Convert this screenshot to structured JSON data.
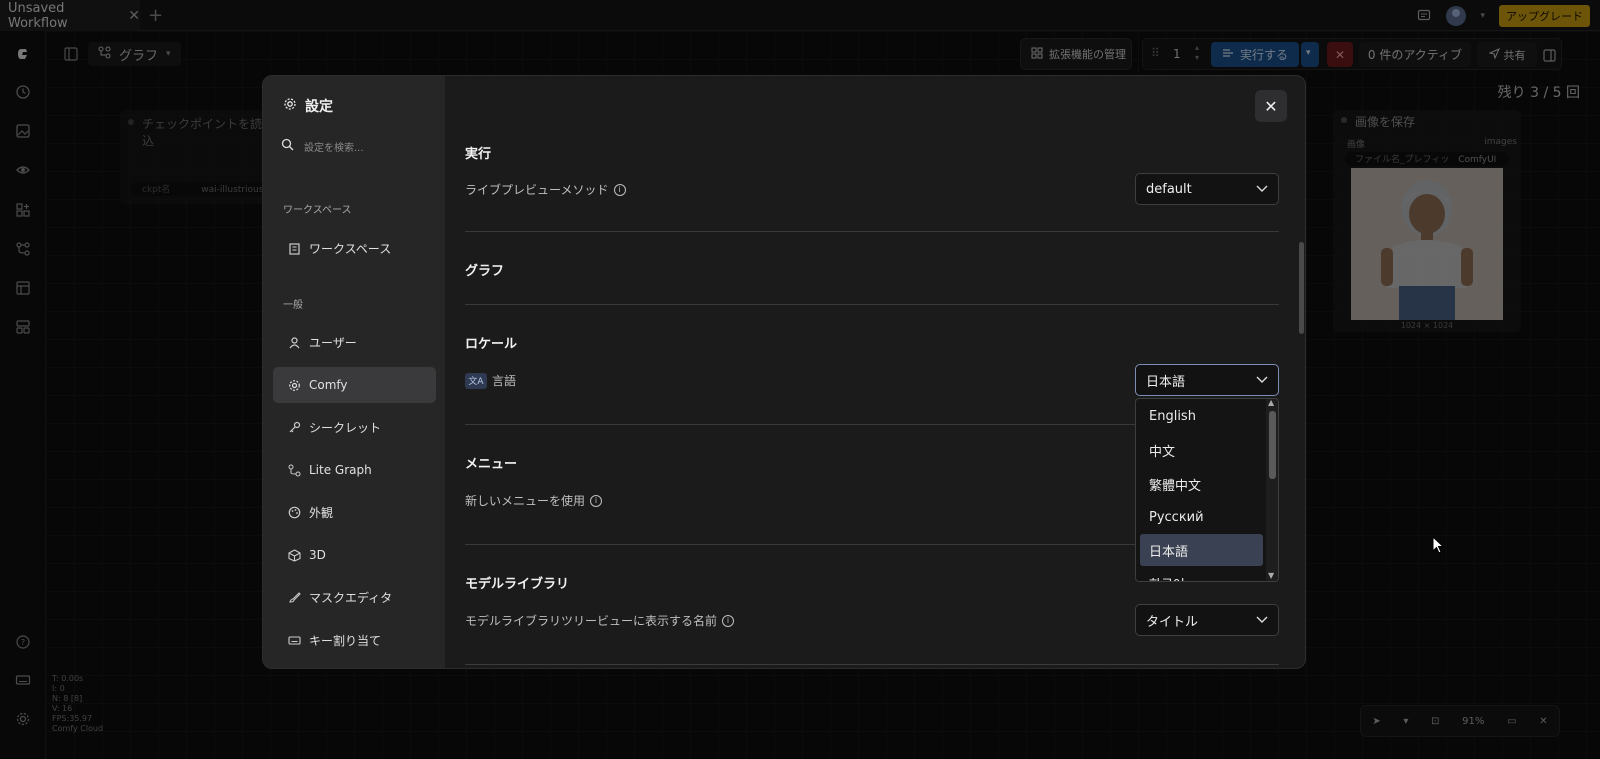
{
  "topbar": {
    "tab_title": "Unsaved Workflow",
    "upgrade_label": "アップグレード"
  },
  "canvas": {
    "graph_label": "グラフ",
    "manage_extensions": "拡張機能の管理",
    "queue_count": "1",
    "run_label": "実行する",
    "active_label": "0 件のアクティブ",
    "share_label": "共有",
    "remaining_label": "残り 3 / 5 回",
    "node_left": {
      "title": "チェックポイントを読み込",
      "widget_name": "ckpt名",
      "widget_value": "wai-illustrious-"
    },
    "node_right": {
      "title": "画像を保存",
      "input": "画像",
      "output": "images",
      "filename_label": "ファイル名_プレフィッ",
      "filename_value": "ComfyUI",
      "size": "1024 × 1024"
    },
    "stats": [
      "T: 0.00s",
      "I: 0",
      "N: 8 [8]",
      "V: 16",
      "FPS:35.97",
      "Comfy Cloud"
    ],
    "zoom": "91%"
  },
  "settings": {
    "title": "設定",
    "search_placeholder": "設定を検索...",
    "groups": [
      {
        "label": "ワークスペース",
        "items": [
          {
            "label": "ワークスペース",
            "icon": "building-icon"
          }
        ]
      },
      {
        "label": "一般",
        "items": [
          {
            "label": "ユーザー",
            "icon": "user-icon"
          },
          {
            "label": "Comfy",
            "icon": "gear-icon",
            "selected": true
          },
          {
            "label": "シークレット",
            "icon": "key-icon"
          },
          {
            "label": "Lite Graph",
            "icon": "graph-icon"
          },
          {
            "label": "外観",
            "icon": "palette-icon"
          },
          {
            "label": "3D",
            "icon": "cube-icon"
          },
          {
            "label": "マスクエディタ",
            "icon": "brush-icon"
          },
          {
            "label": "キー割り当て",
            "icon": "keyboard-icon"
          }
        ]
      }
    ],
    "sections": {
      "execution": {
        "title": "実行",
        "setting_label": "ライブプレビューメソッド",
        "value": "default"
      },
      "graph": {
        "title": "グラフ"
      },
      "locale": {
        "title": "ロケール",
        "badge": "文A",
        "setting_label": "言語",
        "value": "日本語",
        "options": [
          "English",
          "中文",
          "繁體中文",
          "Русский",
          "日本語",
          "한국어"
        ],
        "selected_option": "日本語"
      },
      "menu": {
        "title": "メニュー",
        "setting_label": "新しいメニューを使用"
      },
      "model_library": {
        "title": "モデルライブラリ",
        "setting_label": "モデルライブラリツリービューに表示する名前",
        "value": "タイトル"
      }
    }
  },
  "colors": {
    "accent_run": "#1a4f8a",
    "upgrade": "#c59a12",
    "dropdown_selected": "#3a4152"
  }
}
